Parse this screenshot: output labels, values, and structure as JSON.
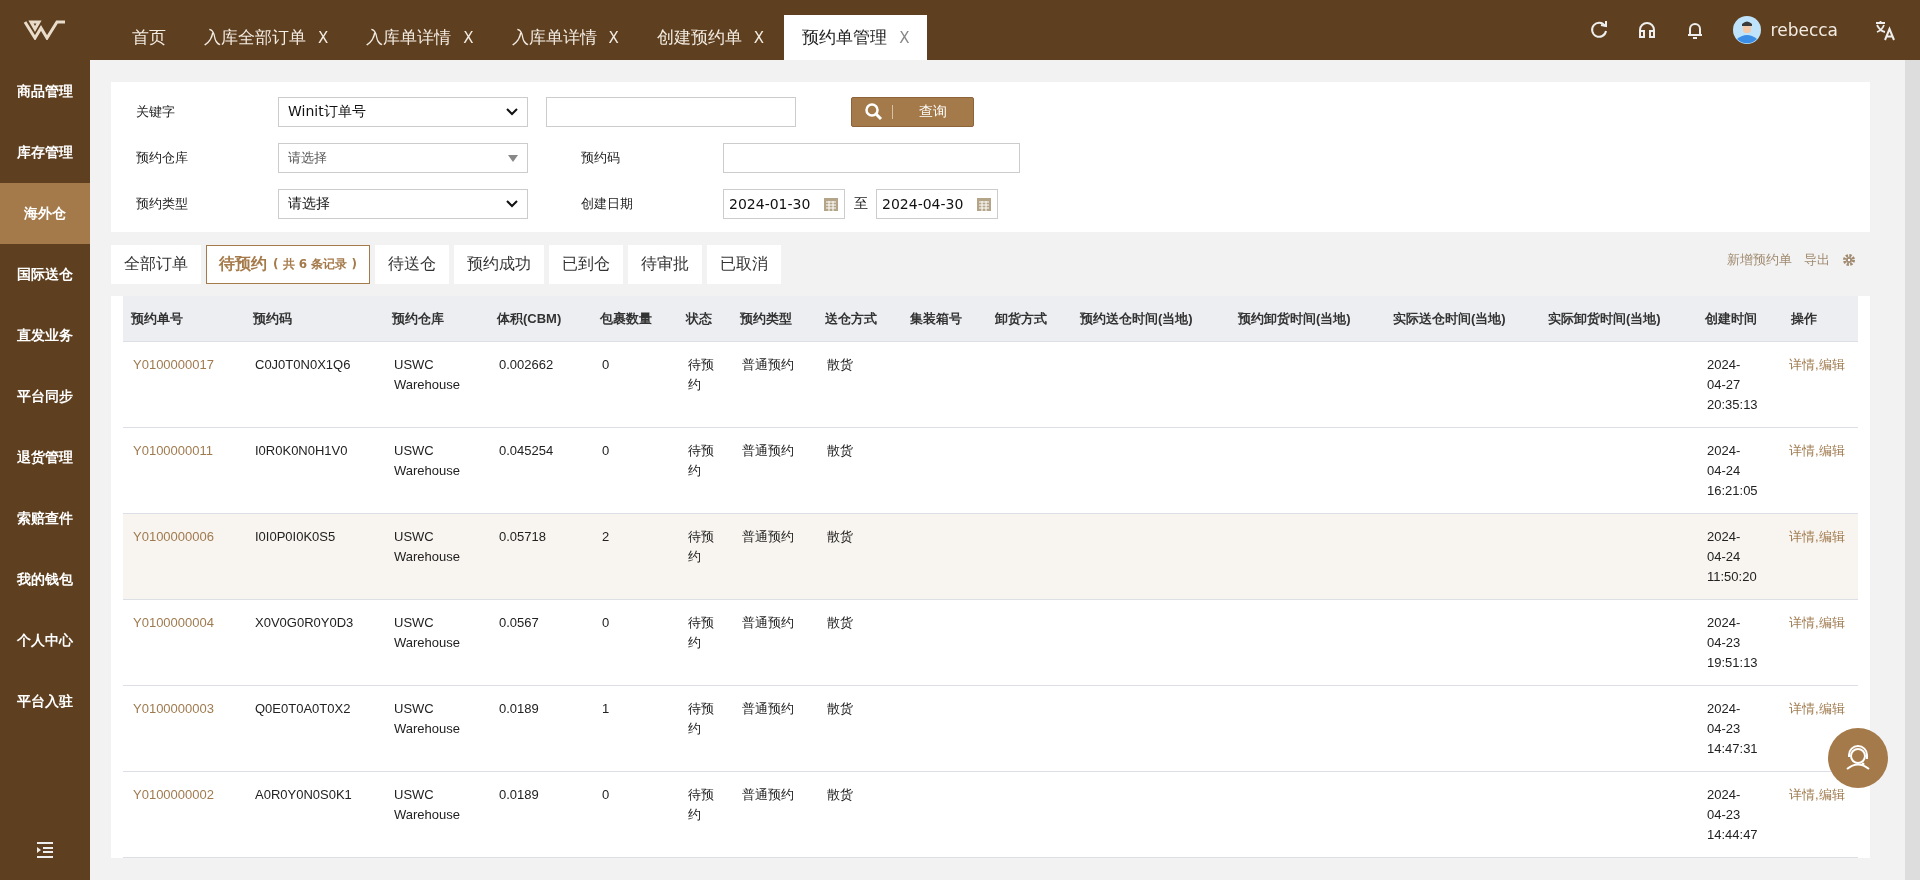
{
  "top_tabs": [
    {
      "label": "首页",
      "selected": false
    },
    {
      "label": "入库全部订单",
      "close": "X",
      "selected": false
    },
    {
      "label": "入库单详情",
      "close": "X",
      "selected": false
    },
    {
      "label": "入库单详情",
      "close": "X",
      "selected": false
    },
    {
      "label": "创建预约单",
      "close": "X",
      "selected": false
    },
    {
      "label": "预约单管理",
      "close": "X",
      "selected": true
    }
  ],
  "user": {
    "name": "rebecca"
  },
  "sidebar": {
    "items": [
      {
        "label": "商品管理",
        "selected": false
      },
      {
        "label": "库存管理",
        "selected": false
      },
      {
        "label": "海外仓",
        "selected": true
      },
      {
        "label": "国际送仓",
        "selected": false
      },
      {
        "label": "直发业务",
        "selected": false
      },
      {
        "label": "平台同步",
        "selected": false
      },
      {
        "label": "退货管理",
        "selected": false
      },
      {
        "label": "索赔查件",
        "selected": false
      },
      {
        "label": "我的钱包",
        "selected": false
      },
      {
        "label": "个人中心",
        "selected": false
      },
      {
        "label": "平台入驻",
        "selected": false
      }
    ]
  },
  "filters": {
    "keyword_label": "关键字",
    "keyword_type": "Winit订单号",
    "search_button": "查询",
    "warehouse_label": "预约仓库",
    "warehouse_placeholder": "请选择",
    "code_label": "预约码",
    "type_label": "预约类型",
    "type_value": "请选择",
    "date_label": "创建日期",
    "date_from": "2024-01-30",
    "date_sep": "至",
    "date_to": "2024-04-30"
  },
  "status_tabs": [
    {
      "label": "全部订单",
      "selected": false
    },
    {
      "label": "待预约",
      "count": "( 共 6 条记录 )",
      "selected": true
    },
    {
      "label": "待送仓",
      "selected": false
    },
    {
      "label": "预约成功",
      "selected": false
    },
    {
      "label": "已到仓",
      "selected": false
    },
    {
      "label": "待审批",
      "selected": false
    },
    {
      "label": "已取消",
      "selected": false
    }
  ],
  "toolbar": {
    "new": "新增预约单",
    "export": "导出"
  },
  "table": {
    "columns": [
      "预约单号",
      "预约码",
      "预约仓库",
      "体积(CBM)",
      "包裹数量",
      "状态",
      "预约类型",
      "送仓方式",
      "集装箱号",
      "卸货方式",
      "预约送仓时间(当地)",
      "预约卸货时间(当地)",
      "实际送仓时间(当地)",
      "实际卸货时间(当地)",
      "创建时间",
      "操作"
    ],
    "rows": [
      {
        "highlighted": false,
        "cells": [
          "Y0100000017",
          "C0J0T0N0X1Q6",
          "USWC Warehouse",
          "0.002662",
          "0",
          "待预约",
          "普通预约",
          "散货"
        ],
        "created": "2024-04-27 20:35:13",
        "actions": [
          "详情",
          "编辑"
        ]
      },
      {
        "highlighted": false,
        "cells": [
          "Y0100000011",
          "I0R0K0N0H1V0",
          "USWC Warehouse",
          "0.045254",
          "0",
          "待预约",
          "普通预约",
          "散货"
        ],
        "created": "2024-04-24 16:21:05",
        "actions": [
          "详情",
          "编辑"
        ]
      },
      {
        "highlighted": true,
        "cells": [
          "Y0100000006",
          "I0I0P0I0K0S5",
          "USWC Warehouse",
          "0.05718",
          "2",
          "待预约",
          "普通预约",
          "散货"
        ],
        "created": "2024-04-24 11:50:20",
        "actions": [
          "详情",
          "编辑"
        ]
      },
      {
        "highlighted": false,
        "cells": [
          "Y0100000004",
          "X0V0G0R0Y0D3",
          "USWC Warehouse",
          "0.0567",
          "0",
          "待预约",
          "普通预约",
          "散货"
        ],
        "created": "2024-04-23 19:51:13",
        "actions": [
          "详情",
          "编辑"
        ]
      },
      {
        "highlighted": false,
        "cells": [
          "Y0100000003",
          "Q0E0T0A0T0X2",
          "USWC Warehouse",
          "0.0189",
          "1",
          "待预约",
          "普通预约",
          "散货"
        ],
        "created": "2024-04-23 14:47:31",
        "actions": [
          "详情",
          "编辑"
        ]
      },
      {
        "highlighted": false,
        "cells": [
          "Y0100000002",
          "A0R0Y0N0S0K1",
          "USWC Warehouse",
          "0.0189",
          "0",
          "待预约",
          "普通预约",
          "散货"
        ],
        "created": "2024-04-23 14:44:47",
        "actions": [
          "详情",
          "编辑"
        ]
      }
    ],
    "action_separator": ","
  }
}
